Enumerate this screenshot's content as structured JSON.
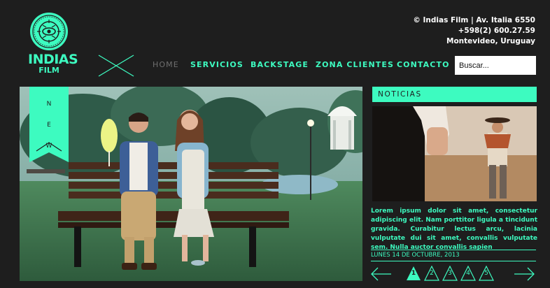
{
  "brand": {
    "name": "INDIAS",
    "sub": "FILM"
  },
  "contact": {
    "line1": "© Indias Film | Av. Italia 6550",
    "line2": "+598(2) 600.27.59",
    "line3": "Montevideo, Uruguay"
  },
  "nav": {
    "home": "HOME",
    "servicios": "SERVICIOS",
    "backstage": "BACKSTAGE",
    "zona_clientes": "ZONA CLIENTES",
    "contacto": "CONTACTO"
  },
  "search": {
    "placeholder": "Buscar..."
  },
  "hero": {
    "badge": "N\n\nE\n\nW"
  },
  "news": {
    "header": "NOTICIAS",
    "body": "Lorem ipsum dolor sit amet, consectetur adipiscing elit. Nam porttitor ligula a tincidunt gravida. Curabitur lectus arcu, lacinia vulputate dui sit amet, convallis vulputate sem. Nulla auctor convallis sapien",
    "date": "LUNES 14 DE OCTUBRE, 2013",
    "pages": [
      "1",
      "2",
      "3",
      "4",
      "5"
    ],
    "active_page": "1"
  },
  "icons": {
    "logo": "indias-seal-icon",
    "x_mark": "x-mark-icon",
    "prev": "arrow-left-icon",
    "next": "arrow-right-icon"
  },
  "colors": {
    "accent": "#3dfbc0",
    "background": "#1e1e1e",
    "inactive_nav": "#6f6f6f"
  }
}
